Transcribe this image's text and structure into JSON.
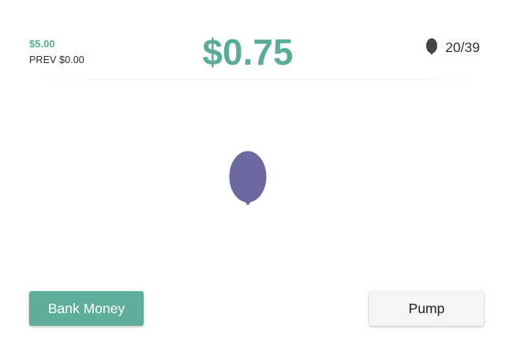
{
  "header": {
    "total_banked": "$5.00",
    "previous_label": "PREV $0.00",
    "current_earnings": "$0.75",
    "balloon_counter": "20/39",
    "counter_icon": "balloon-icon"
  },
  "balloon": {
    "icon": "balloon-icon",
    "color": "#6b69a0"
  },
  "actions": {
    "bank_label": "Bank Money",
    "pump_label": "Pump"
  },
  "colors": {
    "accent": "#5eae9b",
    "balloon": "#6b69a0",
    "counter_icon": "#444444"
  }
}
